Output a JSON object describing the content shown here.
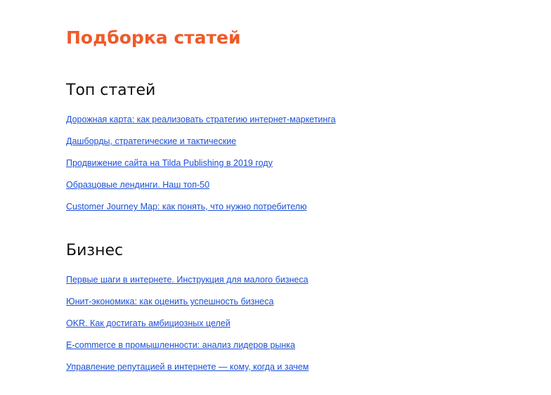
{
  "page": {
    "title": "Подборка статей",
    "title_color": "#f05a28",
    "link_color": "#1a4fd8"
  },
  "sections": [
    {
      "heading": "Топ статей",
      "links": [
        "Дорожная карта: как реализовать стратегию интернет-маркетинга",
        "Дашборды, стратегические и тактические",
        "Продвижение сайта на Tilda Publishing в 2019 году",
        "Образцовые лендинги. Наш топ-50",
        "Customer Journey Map: как понять, что нужно потребителю"
      ]
    },
    {
      "heading": "Бизнес",
      "links": [
        "Первые шаги в интернете. Инструкция для малого бизнеса",
        "Юнит-экономика: как оценить успешность бизнеса",
        "OKR. Как достигать амбициозных целей",
        "E-commerce в промышленности: анализ лидеров рынка",
        "Управление репутацией в интернете — кому, когда и зачем"
      ]
    }
  ]
}
